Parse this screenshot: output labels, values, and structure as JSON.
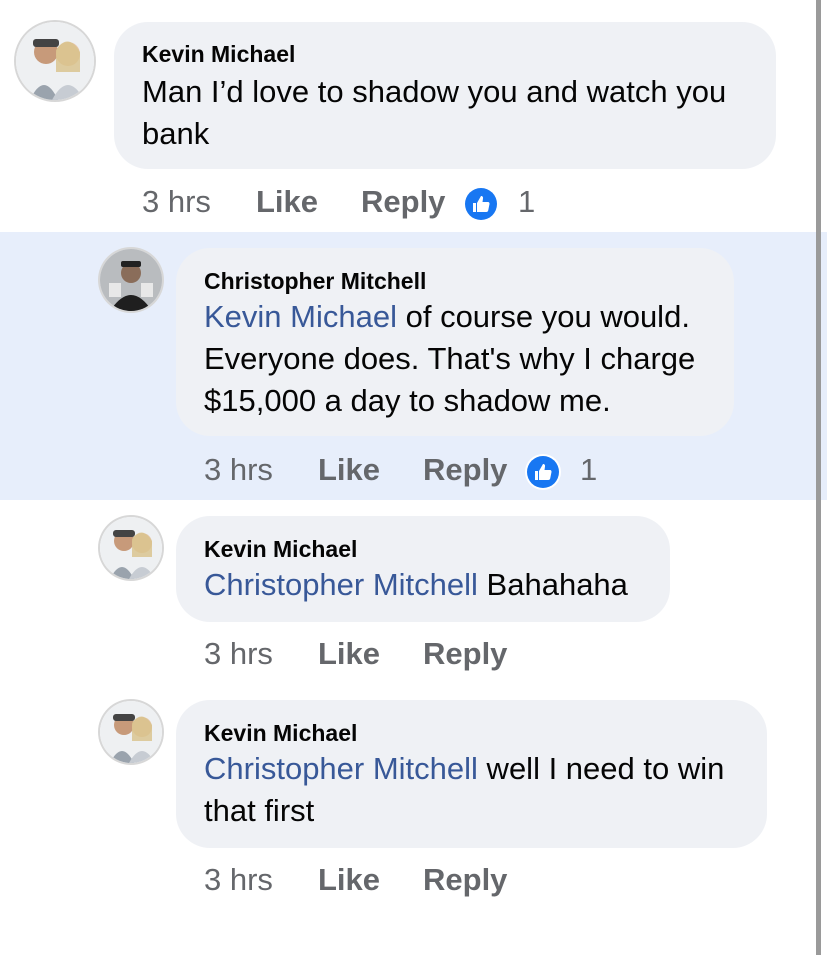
{
  "comments": [
    {
      "author": "Kevin Michael",
      "mention": "",
      "text": "Man I’d love to shadow you and watch you bank",
      "time": "3 hrs",
      "like_label": "Like",
      "reply_label": "Reply",
      "reaction_count": "1"
    },
    {
      "author": "Christopher Mitchell",
      "mention": "Kevin Michael",
      "text": " of course you would. Everyone does. That's why I charge $15,000 a day to shadow me.",
      "time": "3 hrs",
      "like_label": "Like",
      "reply_label": "Reply",
      "reaction_count": "1"
    },
    {
      "author": "Kevin Michael",
      "mention": "Christopher Mitchell",
      "text": " Bahahaha",
      "time": "3 hrs",
      "like_label": "Like",
      "reply_label": "Reply",
      "reaction_count": ""
    },
    {
      "author": "Kevin Michael",
      "mention": "Christopher Mitchell",
      "text": " well I need to win that first",
      "time": "3 hrs",
      "like_label": "Like",
      "reply_label": "Reply",
      "reaction_count": ""
    }
  ],
  "icons": {
    "reaction": "like-thumb-icon",
    "avatar": "avatar"
  },
  "colors": {
    "mention": "#385898",
    "highlight": "#e7eefb",
    "bubble": "#eff1f5",
    "meta": "#65676b",
    "like_badge": "#1877f2"
  }
}
